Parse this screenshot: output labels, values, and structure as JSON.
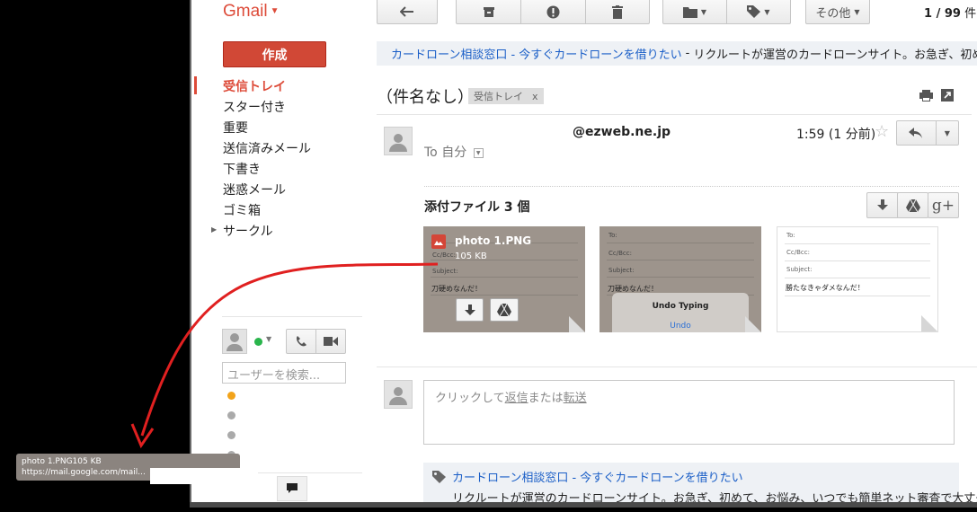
{
  "app": {
    "logo_text": "Gmail"
  },
  "toolbar": {
    "more_label": "その他",
    "pager_range": "1 / 99",
    "pager_unit": "件"
  },
  "sidebar": {
    "compose_label": "作成",
    "items": [
      {
        "label": "受信トレイ"
      },
      {
        "label": "スター付き"
      },
      {
        "label": "重要"
      },
      {
        "label": "送信済みメール"
      },
      {
        "label": "下書き"
      },
      {
        "label": "迷惑メール"
      },
      {
        "label": "ゴミ箱"
      },
      {
        "label": "サークル"
      }
    ]
  },
  "chat": {
    "search_placeholder": "ユーザーを検索...",
    "status_color": "#2ab54c"
  },
  "ad_top": {
    "link_text": "カードローン相談窓口 - 今すぐカードローンを借りたい",
    "separator": "-",
    "description": "リクルートが運営のカードローンサイト。お急ぎ、初めて"
  },
  "message": {
    "subject": "（件名なし）",
    "label_chip": "受信トレイ",
    "label_close": "x",
    "sender": "@ezweb.ne.jp",
    "to_line": "To 自分",
    "time": "1:59 (1 分前)",
    "attachments_title": "添付ファイル 3 個",
    "attachments": [
      {
        "name": "photo 1.PNG",
        "size": "105 KB",
        "body_text": "刀硬めなんだ！",
        "fields": [
          "To:",
          "Cc/Bcc:",
          "Subject:"
        ]
      },
      {
        "body_text": "刀硬めなんだ！",
        "dialog_text": "Undo Typing",
        "dialog_sub": "Undo",
        "fields": [
          "To:",
          "Cc/Bcc:",
          "Subject:"
        ]
      },
      {
        "body_text": "勝たなきゃダメなんだ！",
        "fields": [
          "To:",
          "Cc/Bcc:",
          "Subject:"
        ]
      }
    ]
  },
  "reply": {
    "prefix": "クリックして",
    "reply_link": "返信",
    "middle": "または",
    "forward_link": "転送"
  },
  "ad_bottom": {
    "link_text": "カードローン相談窓口 - 今すぐカードローンを借りたい",
    "description": "リクルートが運営のカードローンサイト。お急ぎ、初めて、お悩み、いつでも簡単ネット審査で大丈夫！"
  },
  "status_tooltip": {
    "line1": "photo 1.PNG105 KB",
    "line2": "https://mail.google.com/mail..."
  },
  "colors": {
    "accent": "#dd4b39",
    "compose": "#d14836",
    "link": "#1a5ec7",
    "annotation": "#e02020"
  }
}
